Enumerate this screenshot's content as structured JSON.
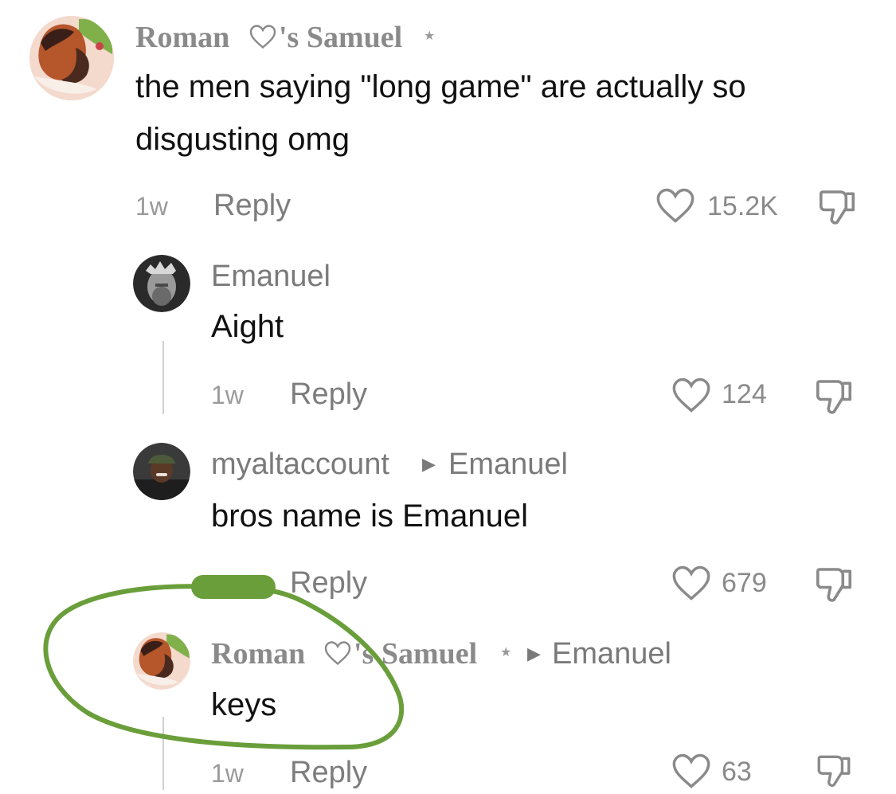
{
  "comments": [
    {
      "author_part1": "Roman",
      "author_part2": "'s Samuel",
      "text": "the men saying \"long game\" are actually so disgusting omg",
      "age": "1w",
      "reply_label": "Reply",
      "likes": "15.2K"
    },
    {
      "author": "Emanuel",
      "text": "Aight",
      "age": "1w",
      "reply_label": "Reply",
      "likes": "124"
    },
    {
      "author": "myaltaccount",
      "reply_to": "Emanuel",
      "text": "bros name is Emanuel",
      "reply_label": "Reply",
      "likes": "679"
    },
    {
      "author_part1": "Roman",
      "author_part2": "'s Samuel",
      "reply_to": "Emanuel",
      "text": "keys",
      "age": "1w",
      "reply_label": "Reply",
      "likes": "63"
    }
  ],
  "colors": {
    "annotation_green": "#6a9e3a",
    "text_gray": "#8a8a8a",
    "line_gray": "#d0d0d0"
  },
  "icons": [
    "heart-outline-icon",
    "thumb-down-icon",
    "reply-arrow-icon",
    "verified-dot"
  ]
}
